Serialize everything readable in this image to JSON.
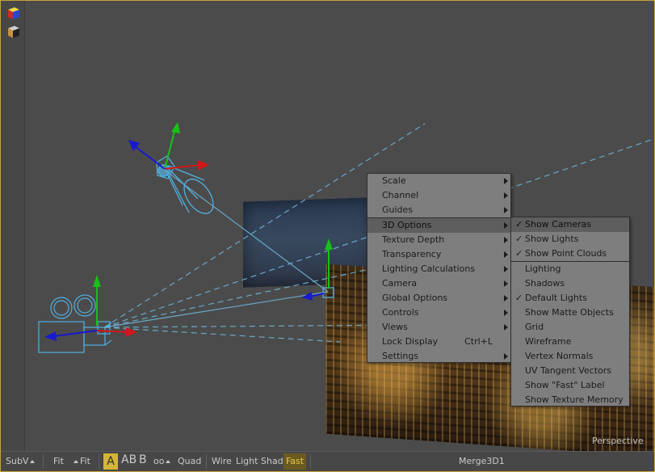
{
  "viewport": {
    "perspective_label": "Perspective"
  },
  "left_tools": {
    "icons": [
      "3d-cube-color-icon",
      "3d-cube-icon"
    ]
  },
  "context_menu": {
    "items": [
      {
        "label": "Scale",
        "submenu": true
      },
      {
        "label": "Channel",
        "submenu": true
      },
      {
        "label": "Guides",
        "submenu": true
      },
      {
        "label": "3D Options",
        "submenu": true,
        "highlighted": true
      },
      {
        "label": "Texture Depth",
        "submenu": true
      },
      {
        "label": "Transparency",
        "submenu": true
      },
      {
        "label": "Lighting Calculations",
        "submenu": true
      },
      {
        "label": "Camera",
        "submenu": true
      },
      {
        "label": "Global Options",
        "submenu": true
      },
      {
        "label": "Controls",
        "submenu": true
      },
      {
        "label": "Views",
        "submenu": true
      },
      {
        "label": "Lock Display",
        "shortcut": "Ctrl+L"
      },
      {
        "label": "Settings",
        "submenu": true
      }
    ]
  },
  "submenu_3d_options": {
    "items": [
      {
        "label": "Show Cameras",
        "checked": true,
        "highlighted": true
      },
      {
        "label": "Show Lights",
        "checked": true
      },
      {
        "label": "Show Point Clouds",
        "checked": true
      },
      {
        "label": "Lighting",
        "checked": false
      },
      {
        "label": "Shadows",
        "checked": false
      },
      {
        "label": "Default Lights",
        "checked": true
      },
      {
        "label": "Show Matte Objects",
        "checked": false
      },
      {
        "label": "Grid",
        "checked": false
      },
      {
        "label": "Wireframe",
        "checked": false
      },
      {
        "label": "Vertex Normals",
        "checked": false
      },
      {
        "label": "UV Tangent Vectors",
        "checked": false
      },
      {
        "label": "Show \"Fast\" Label",
        "checked": false
      },
      {
        "label": "Show Texture Memory",
        "checked": false
      }
    ],
    "check_glyph": "✓"
  },
  "toolbar": {
    "subv": "SubV",
    "fit1": "Fit",
    "fit2": "Fit",
    "a": "A",
    "ab": "AB",
    "b": "B",
    "glasses": "oo",
    "quad": "Quad",
    "wire": "Wire",
    "light": "Light",
    "shad": "Shad",
    "fast": "Fast",
    "view_name": "Merge3D1"
  },
  "colors": {
    "frame_border": "#c8a23a",
    "viewport_bg": "#4b4b4b",
    "menu_bg": "#7e7e7e",
    "menu_highlight": "#5e5e5e",
    "gizmo_blue": "#52b0e0",
    "axis_red": "#d01818",
    "axis_green": "#18c018",
    "axis_blue": "#1818d0"
  }
}
